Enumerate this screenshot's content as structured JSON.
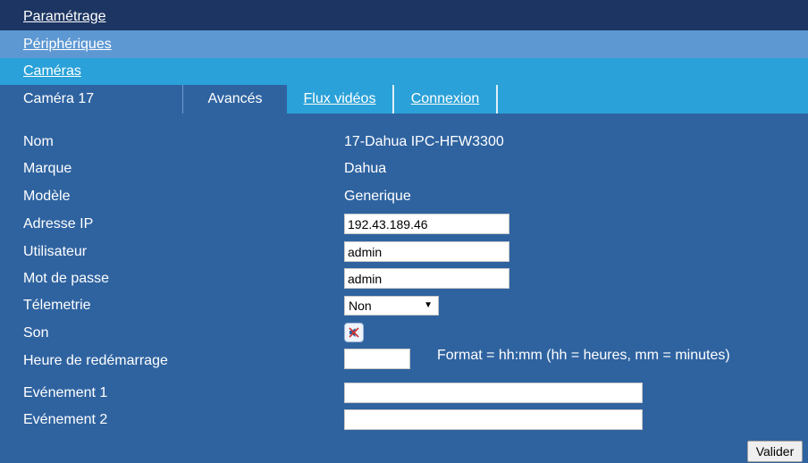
{
  "nav": {
    "level1": "Paramétrage",
    "level2": "Périphériques",
    "level3": "Caméras"
  },
  "tabs": {
    "title": "Caméra 17",
    "advanced": "Avancés",
    "video_streams": "Flux vidéos",
    "connection": "Connexion"
  },
  "form": {
    "name_label": "Nom",
    "name_value": "17-Dahua IPC-HFW3300",
    "brand_label": "Marque",
    "brand_value": "Dahua",
    "model_label": "Modèle",
    "model_value": "Generique",
    "ip_label": "Adresse IP",
    "ip_value": "192.43.189.46",
    "user_label": "Utilisateur",
    "user_value": "admin",
    "password_label": "Mot de passe",
    "password_value": "admin",
    "telemetry_label": "Télemetrie",
    "telemetry_value": "Non",
    "sound_label": "Son",
    "sound_icon": "speaker-muted-icon",
    "reboot_label": "Heure de redémarrage",
    "reboot_value": "",
    "reboot_hint": "Format = hh:mm  (hh = heures, mm = minutes)",
    "event1_label": "Evénement 1",
    "event1_value": "",
    "event2_label": "Evénement 2",
    "event2_value": ""
  },
  "actions": {
    "validate": "Valider"
  },
  "colors": {
    "background": "#2f63a0",
    "nav1": "#1d3562",
    "nav2": "#5e98d3",
    "nav3": "#2aa1d8"
  }
}
